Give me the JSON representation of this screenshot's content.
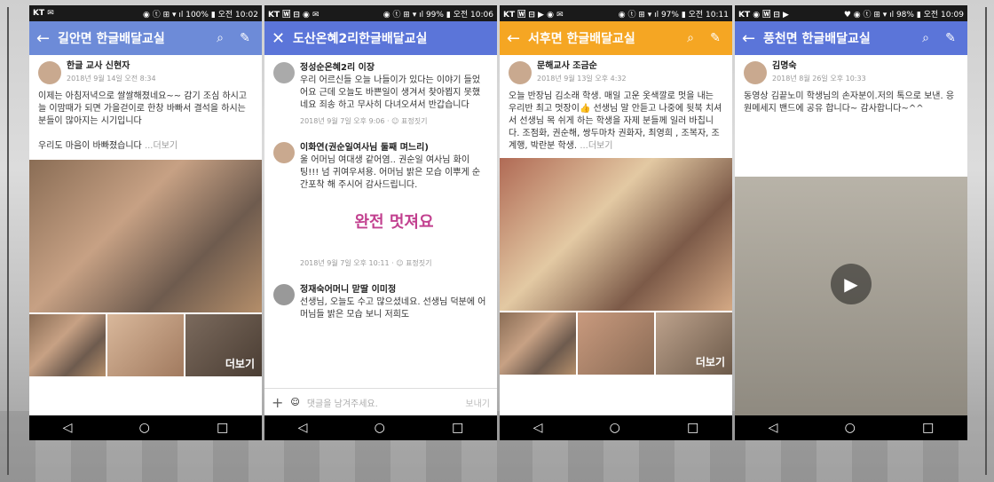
{
  "phones": [
    {
      "status_left": "KT ✉",
      "status_right": "◉ ⓣ ⊞ ▾ ıl 100% ▮ 오전 10:02",
      "header_color": "#6d8bd8",
      "title": "길안면 한글배달교실",
      "author": "한글 교사 신현자",
      "date": "2018년 9월 14일 오전 8:34",
      "text": "이제는 아침저녁으로 쌀쌀해졌네요~~ 감기 조심 하시고  늘 이맘때가 되면 가을걷이로  한창 바빠서 결석을 하시는 분들이  많아지는 시기입니다",
      "text2": "우리도 마음이 바빠졌습니다",
      "more": "...더보기",
      "more_overlay": "더보기"
    },
    {
      "status_left": "KT 🅆 ⊟ ◉ ✉",
      "status_right": "◉ ⓣ ⊞ ▾ ıl 99% ▮ 오전 10:06",
      "header_color": "#5b75d9",
      "title": "도산온혜2리한글배달교실",
      "c1_author": "정성순온혜2리 이장",
      "c1_text": "우리 어르신들 오늘 나들이가 있다는 이야기 들었어요  근데 오늘도 바쁜일이 생겨서 찾아뵙지 못했네요 죄송 하고 무사히 다녀오셔서 반갑습니다",
      "c1_meta": "2018년 9월 7일 오후 9:06 · ☺ 표정짓기",
      "c2_author": "이화연(권순일여사님 둘째 며느리)",
      "c2_text": "울 어머님 여대생 같어염.. 권순일 여사님 화이팅!!! 넘 귀여우셔용. 어머님 밝은 모습 이뿌게 순간포착  해 주시어 감사드립니다.",
      "sticker": "완전 멋져요",
      "c2_meta": "2018년 9월 7일 오후 10:11 · ☺ 표정짓기",
      "c3_author": "정재숙어머니 맏딸 이미정",
      "c3_text": "선생님, 오늘도 수고 많으셨네요.  선생님 덕분에 어머님들 밝은 모습 보니 저희도",
      "comment_placeholder": "댓글을 남겨주세요.",
      "send": "보내기"
    },
    {
      "status_left": "KT 🅆 ⊟ ▶ ◉ ✉",
      "status_right": "◉ ⓣ ⊞ ▾ ıl 97% ▮ 오전 10:11",
      "header_color": "#f5a623",
      "title": "서후면 한글배달교실",
      "author": "문해교사 조금순",
      "date": "2018년 9월 13일 오후 4:32",
      "text": "오늘 반장님 김소래 학생. 매일 고운 옷색깔로 멋을 내는 우리반 최고 멋장이👍 선생님 말 안듣고 나중에 뒷북 치셔서 선생님 목 쉬게 하는 학생을 자제 분들께 일러 바칩니다. 조점화, 권순해, 쌍두마차 권화자, 최영희 , 조복자, 조계행, 박란분 학생.",
      "more": "...더보기",
      "more_overlay": "더보기"
    },
    {
      "status_left": "KT ◉ 🅆 ⊟ ▶",
      "status_right": "♥ ◉ ⓣ ⊞ ▾ ıl 98% ▮ 오전 10:09",
      "header_color": "#5b75d9",
      "title": "풍천면 한글배달교실",
      "author": "김명숙",
      "date": "2018년 8월 26일 오후 10:33",
      "text": "동영상 김끝노미 학생님의 손자분이.저의 톡으로 보낸. 응원메세지 밴드에 공유 합니다~ 감사합니다~^^"
    }
  ]
}
